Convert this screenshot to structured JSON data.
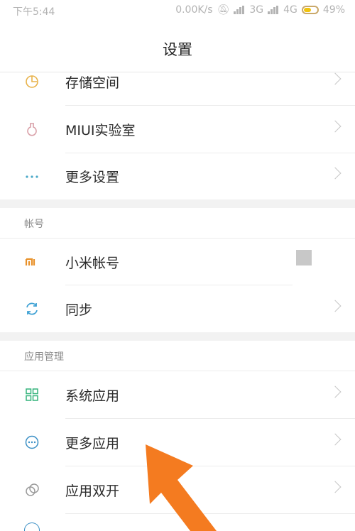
{
  "status_bar": {
    "time": "下午5:44",
    "network_speed": "0.00K/s",
    "network_3g": "3G",
    "network_4g": "4G",
    "battery": "49%"
  },
  "header": {
    "title": "设置"
  },
  "top_items": [
    {
      "label": "存储空间",
      "icon": "storage-icon"
    },
    {
      "label": "MIUI实验室",
      "icon": "lab-flask-icon"
    },
    {
      "label": "更多设置",
      "icon": "more-dots-icon"
    }
  ],
  "account_section": {
    "title": "帐号",
    "items": [
      {
        "label": "小米帐号",
        "icon": "mi-logo-icon"
      },
      {
        "label": "同步",
        "icon": "sync-icon"
      }
    ]
  },
  "apps_section": {
    "title": "应用管理",
    "items": [
      {
        "label": "系统应用",
        "icon": "grid-apps-icon"
      },
      {
        "label": "更多应用",
        "icon": "more-apps-icon"
      },
      {
        "label": "应用双开",
        "icon": "dual-apps-icon"
      }
    ]
  },
  "colors": {
    "accent_orange": "#f47b20",
    "status_gray": "#b3b3b3"
  }
}
